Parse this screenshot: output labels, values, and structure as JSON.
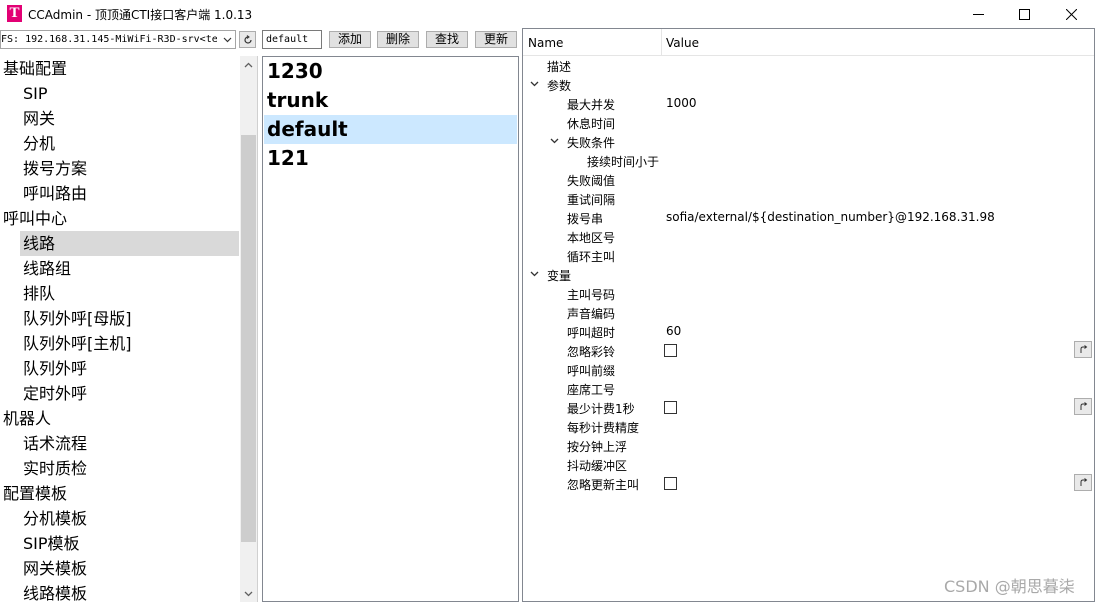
{
  "window": {
    "logo_letter": "T",
    "title": "CCAdmin - 顶顶通CTI接口客户端 1.0.13"
  },
  "toolbar": {
    "connection_value": "FS: 192.168.31.145-MiWiFi-R3D-srv<tes",
    "name_value": "default",
    "add_label": "添加",
    "delete_label": "删除",
    "find_label": "查找",
    "update_label": "更新"
  },
  "nav": {
    "items": [
      {
        "label": "基础配置",
        "level": 0
      },
      {
        "label": "SIP",
        "level": 1
      },
      {
        "label": "网关",
        "level": 1
      },
      {
        "label": "分机",
        "level": 1
      },
      {
        "label": "拨号方案",
        "level": 1
      },
      {
        "label": "呼叫路由",
        "level": 1
      },
      {
        "label": "呼叫中心",
        "level": 0
      },
      {
        "label": "线路",
        "level": 1,
        "selected": true
      },
      {
        "label": "线路组",
        "level": 1
      },
      {
        "label": "排队",
        "level": 1
      },
      {
        "label": "队列外呼[母版]",
        "level": 1
      },
      {
        "label": "队列外呼[主机]",
        "level": 1
      },
      {
        "label": "队列外呼",
        "level": 1
      },
      {
        "label": "定时外呼",
        "level": 1
      },
      {
        "label": "机器人",
        "level": 0
      },
      {
        "label": "话术流程",
        "level": 1
      },
      {
        "label": "实时质检",
        "level": 1
      },
      {
        "label": "配置模板",
        "level": 0
      },
      {
        "label": "分机模板",
        "level": 1
      },
      {
        "label": "SIP模板",
        "level": 1
      },
      {
        "label": "网关模板",
        "level": 1
      },
      {
        "label": "线路模板",
        "level": 1
      }
    ]
  },
  "list": {
    "items": [
      {
        "label": "1230"
      },
      {
        "label": "trunk"
      },
      {
        "label": "default",
        "selected": true
      },
      {
        "label": "121"
      }
    ]
  },
  "props": {
    "col_name": "Name",
    "col_value": "Value",
    "rows": [
      {
        "name": "描述",
        "depth": 1,
        "value": ""
      },
      {
        "name": "参数",
        "depth": 0,
        "expander": true,
        "value": ""
      },
      {
        "name": "最大并发",
        "depth": 2,
        "value": "1000"
      },
      {
        "name": "休息时间",
        "depth": 2,
        "value": ""
      },
      {
        "name": "失败条件",
        "depth": 1.5,
        "expander": true,
        "value": ""
      },
      {
        "name": "接续时间小于",
        "depth": 3,
        "value": ""
      },
      {
        "name": "失败阈值",
        "depth": 2,
        "value": ""
      },
      {
        "name": "重试间隔",
        "depth": 2,
        "value": ""
      },
      {
        "name": "拨号串",
        "depth": 2,
        "value": "sofia/external/${destination_number}@192.168.31.98"
      },
      {
        "name": "本地区号",
        "depth": 2,
        "value": ""
      },
      {
        "name": "循环主叫",
        "depth": 2,
        "value": ""
      },
      {
        "name": "变量",
        "depth": 0,
        "expander": true,
        "value": ""
      },
      {
        "name": "主叫号码",
        "depth": 2,
        "value": ""
      },
      {
        "name": "声音编码",
        "depth": 2,
        "value": ""
      },
      {
        "name": "呼叫超时",
        "depth": 2,
        "value": "60"
      },
      {
        "name": "忽略彩铃",
        "depth": 2,
        "value": "",
        "checkbox": true,
        "checked": false
      },
      {
        "name": "呼叫前缀",
        "depth": 2,
        "value": ""
      },
      {
        "name": "座席工号",
        "depth": 2,
        "value": ""
      },
      {
        "name": "最少计费1秒",
        "depth": 2,
        "value": "",
        "checkbox": true,
        "checked": false
      },
      {
        "name": "每秒计费精度",
        "depth": 2,
        "value": ""
      },
      {
        "name": "按分钟上浮",
        "depth": 2,
        "value": ""
      },
      {
        "name": "抖动缓冲区",
        "depth": 2,
        "value": ""
      },
      {
        "name": "忽略更新主叫",
        "depth": 2,
        "value": "",
        "checkbox": true,
        "checked": false
      }
    ]
  },
  "watermark": "CSDN @朝思暮柒",
  "colors": {
    "selection_nav": "#d9d9d9",
    "selection_list": "#cce8ff",
    "logo": "#e20074"
  }
}
